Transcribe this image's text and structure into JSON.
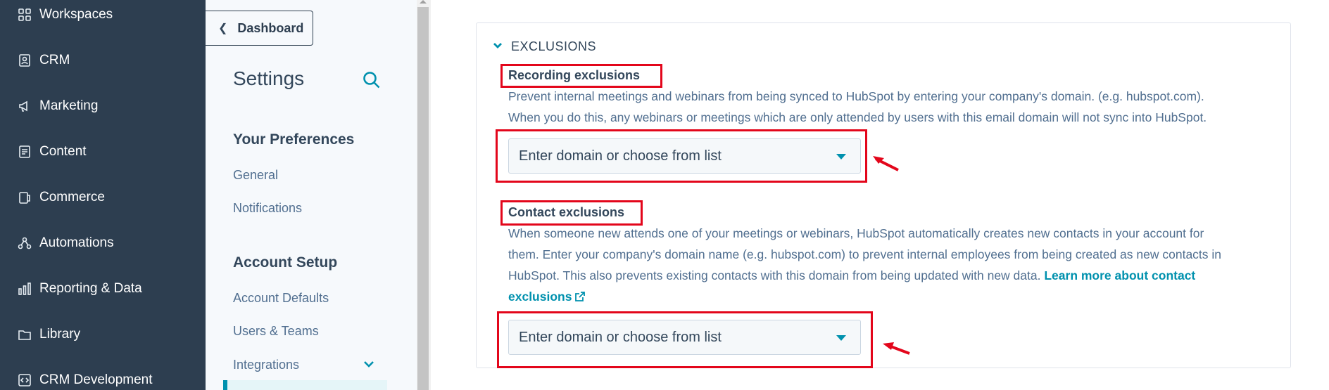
{
  "nav": {
    "items": [
      {
        "label": "Workspaces",
        "icon": "grid-icon"
      },
      {
        "label": "CRM",
        "icon": "contacts-icon"
      },
      {
        "label": "Marketing",
        "icon": "megaphone-icon"
      },
      {
        "label": "Content",
        "icon": "document-icon"
      },
      {
        "label": "Commerce",
        "icon": "commerce-icon"
      },
      {
        "label": "Automations",
        "icon": "automation-icon"
      },
      {
        "label": "Reporting & Data",
        "icon": "bar-chart-icon"
      },
      {
        "label": "Library",
        "icon": "folder-icon"
      },
      {
        "label": "CRM Development",
        "icon": "code-icon"
      }
    ]
  },
  "settings": {
    "dashboard_label": "Dashboard",
    "title": "Settings",
    "sections": [
      {
        "heading": "Your Preferences",
        "links": [
          "General",
          "Notifications"
        ]
      },
      {
        "heading": "Account Setup",
        "links": [
          "Account Defaults",
          "Users & Teams",
          "Integrations"
        ]
      }
    ]
  },
  "exclusions": {
    "heading": "EXCLUSIONS",
    "recording": {
      "label": "Recording exclusions",
      "help_line1": "Prevent internal meetings and webinars from being synced to HubSpot by entering your company's domain. (e.g. hubspot.com).",
      "help_line2": "When you do this, any webinars or meetings which are only attended by users with this email domain will not sync into HubSpot.",
      "select_placeholder": "Enter domain or choose from list"
    },
    "contact": {
      "label": "Contact exclusions",
      "help_line1": "When someone new attends one of your meetings or webinars, HubSpot automatically creates new contacts in your account for",
      "help_line2": "them. Enter your company's domain name (e.g. hubspot.com) to prevent internal employees from being created as new contacts in",
      "help_line3": "HubSpot. This also prevents existing contacts with this domain from being updated with new data.",
      "link_part1": "Learn more about contact",
      "link_part2": "exclusions",
      "select_placeholder": "Enter domain or choose from list"
    }
  },
  "colors": {
    "nav_bg": "#2d3e50",
    "accent": "#0091ae",
    "annotation_red": "#e3061b"
  }
}
